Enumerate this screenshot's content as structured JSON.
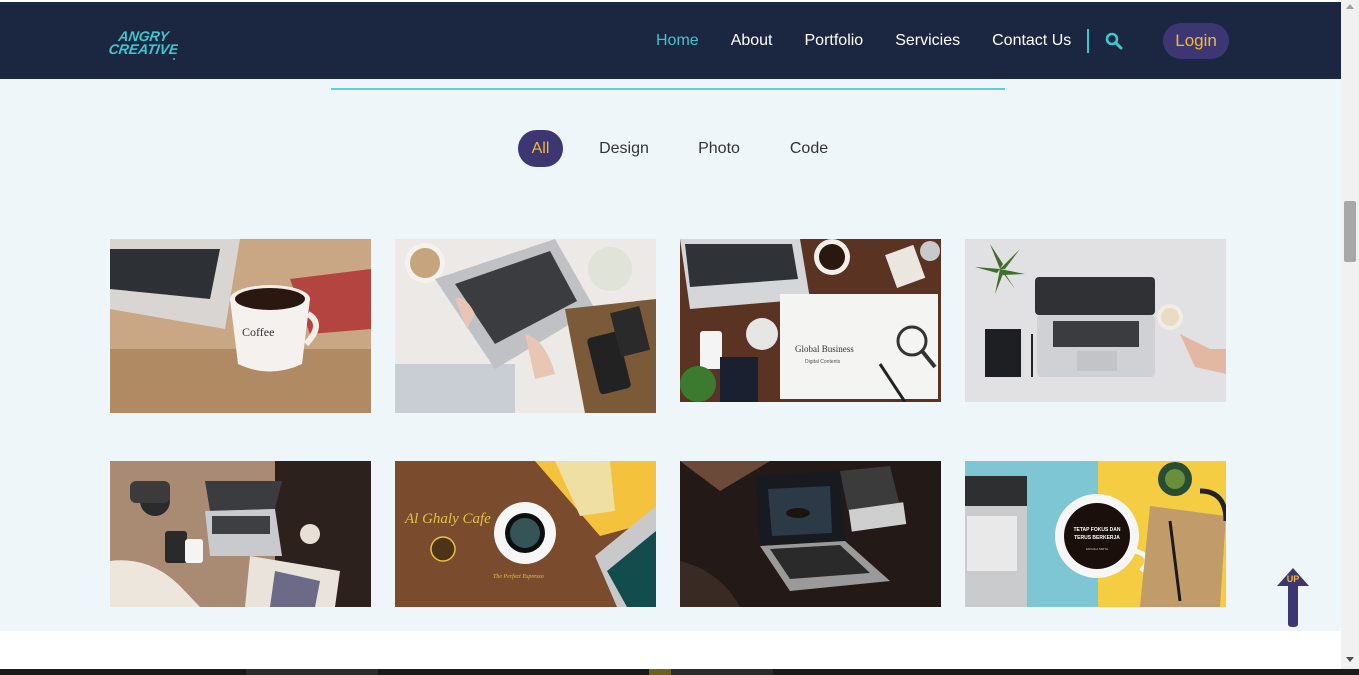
{
  "header": {
    "logo_line1": "ANGRY",
    "logo_line2": "CREATIVE",
    "logo_icon": "angry-creative-logo",
    "nav": [
      {
        "label": "Home",
        "active": true
      },
      {
        "label": "About",
        "active": false
      },
      {
        "label": "Portfolio",
        "active": false
      },
      {
        "label": "Servicies",
        "active": false
      },
      {
        "label": "Contact Us",
        "active": false
      }
    ],
    "search_icon": "search-icon",
    "login_label": "Login"
  },
  "filters": [
    {
      "label": "All",
      "active": true
    },
    {
      "label": "Design",
      "active": false
    },
    {
      "label": "Photo",
      "active": false
    },
    {
      "label": "Code",
      "active": false
    }
  ],
  "portfolio": [
    {
      "subject": "coffee mug and laptop on wooden desk",
      "mug_text": "Coffee"
    },
    {
      "subject": "hands typing on laptop with phone and notebooks"
    },
    {
      "subject": "laptop, coffee and magnifier on dark wood desk",
      "paper_title": "Global Business",
      "paper_subtitle": "Digital Contents"
    },
    {
      "subject": "laptop, coffee and plant on white desk"
    },
    {
      "subject": "laptop, camera and magazines flat lay"
    },
    {
      "subject": "coffee cup with laptop on wooden table",
      "brand_text": "Al Ghaly Cafe",
      "caption_text": "The Perfect Espresso"
    },
    {
      "subject": "laptop with coffee cup in dark room"
    },
    {
      "subject": "coffee cup with notebook on blue and yellow background",
      "cup_text_line1": "TETAP FOKUS DAN",
      "cup_text_line2": "TERUS BERKERJA",
      "cup_text_line3": "FADHILA SMITH"
    }
  ],
  "back_to_top": {
    "label": "UP",
    "icon": "arrow-up-icon"
  },
  "colors": {
    "header_bg": "#1b2640",
    "accent_teal": "#3fc6cf",
    "accent_purple": "#3c3673",
    "accent_gold": "#f5b83a",
    "page_bg": "#eef6f9"
  }
}
